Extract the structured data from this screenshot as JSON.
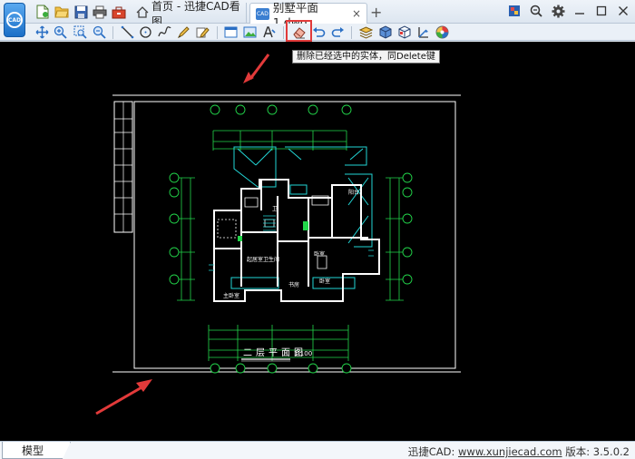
{
  "app": {
    "logo_text": "CAD",
    "quick_access": [
      "new-file-icon",
      "open-folder-icon",
      "save-icon",
      "print-icon",
      "toolbox-icon"
    ]
  },
  "tabs": {
    "home": "首页 - 迅捷CAD看图",
    "active": "别墅平面1.dwg",
    "active_badge": "CAD",
    "close": "×",
    "add": "+"
  },
  "toolbar": {
    "tooltip": "删除已经选中的实体，同Delete键"
  },
  "drawing": {
    "title": "二层平面图",
    "scale": "1:100",
    "rooms": [
      "主卧室",
      "卧室",
      "卧室",
      "起居室卫生间",
      "书房",
      "卫",
      "阳台"
    ]
  },
  "statusbar": {
    "model_tab": "模型",
    "prefix": "迅捷CAD: ",
    "link": "www.xunjiecad.com",
    "version": " 版本: 3.5.0.2"
  },
  "colors": {
    "cad_white": "#ffffff",
    "cad_green": "#22d64a",
    "cad_cyan": "#22d6d6",
    "arrow_red": "#e23a3a",
    "accent_blue": "#1b6fc7"
  }
}
